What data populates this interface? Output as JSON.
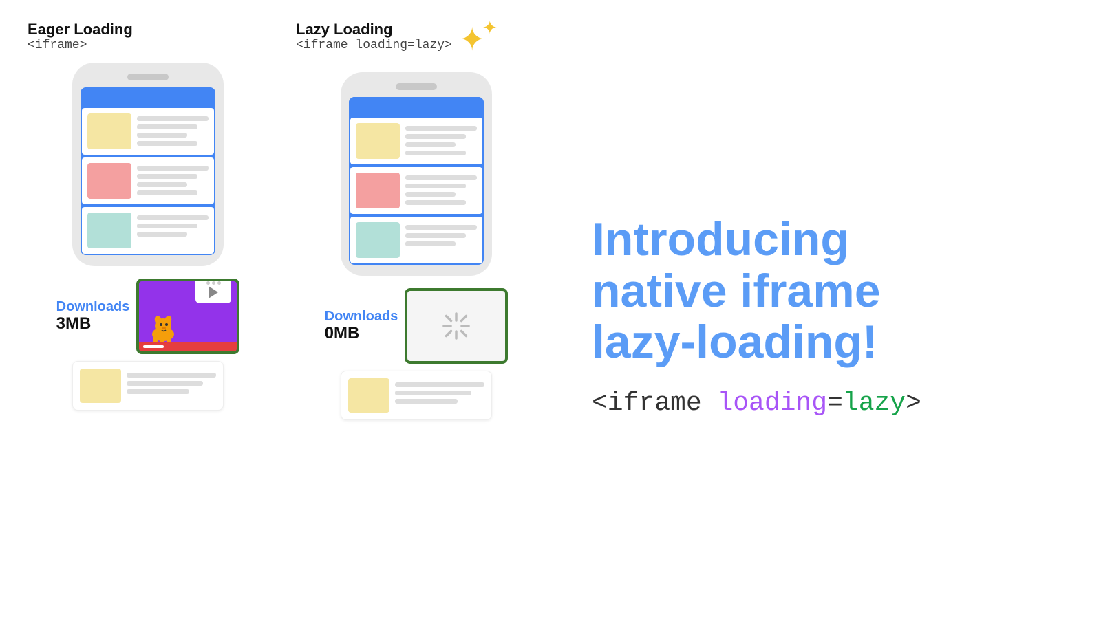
{
  "left_col": {
    "title": "Eager Loading",
    "subtitle": "<iframe>",
    "downloads_label": "Downloads",
    "download_size": "3MB"
  },
  "right_col": {
    "title": "Lazy Loading",
    "subtitle": "<iframe loading=lazy>",
    "downloads_label": "Downloads",
    "download_size": "0MB"
  },
  "heading": {
    "line1": "Introducing",
    "line2": "native iframe",
    "line3": "lazy-loading!"
  },
  "code": {
    "part1": "<iframe ",
    "part2": "loading",
    "part3": "=",
    "part4": "lazy",
    "part5": ">"
  },
  "colors": {
    "blue": "#4285f4",
    "purple": "#9333ea",
    "green": "#16a34a",
    "heading_blue": "#5b9cf6",
    "yellow": "#f4c430"
  }
}
